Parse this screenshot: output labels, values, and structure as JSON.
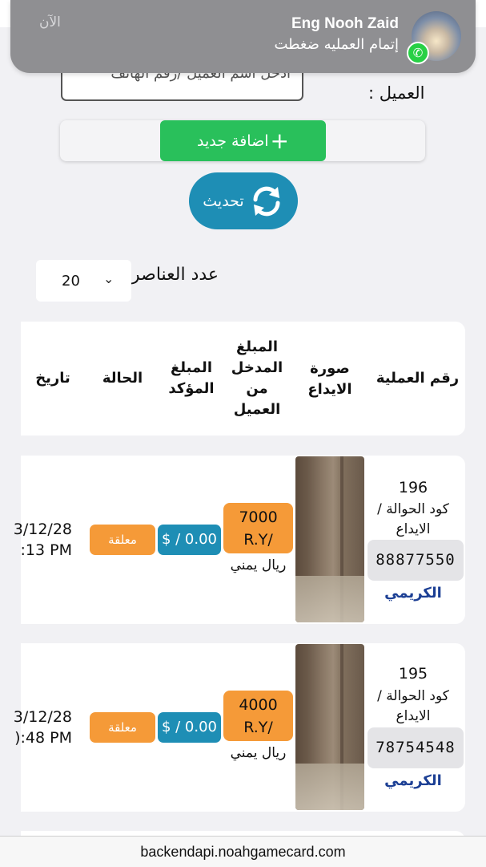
{
  "notification": {
    "title": "Eng Nooh Zaid",
    "body": "إتمام العمليه ضغطت",
    "time": "الآن",
    "badge_icon": "whatsapp-icon",
    "badge_color": "#27d045"
  },
  "client_search": {
    "label": "العميل :",
    "placeholder": "ادخل اسم العميل /رقم الهاتف"
  },
  "actions": {
    "add_label": "اضافة جديد",
    "add_icon": "plus-icon",
    "refresh_label": "تحديث",
    "refresh_icon": "refresh-icon"
  },
  "page_size": {
    "label": "عدد العناصر",
    "value": "20"
  },
  "table": {
    "headers": {
      "op_number": "رقم العملية",
      "photo": "صورة الايداع",
      "entered_amount": "المبلغ المدخل من العميل",
      "confirmed_amount": "المبلغ المؤكد",
      "status": "الحالة",
      "date": "تاريخ"
    },
    "rows": [
      {
        "op_number": "196",
        "code_label": "كود الحوالة / الايداع",
        "code": "88877550",
        "bank": "الكريمي",
        "amount": "7000",
        "amount_unit": "R.Y/",
        "currency": "ريال يمني",
        "confirmed": "$ / 0.00",
        "status": "معلقة",
        "date_line1": "3/12/28",
        "date_line2": ":13 PM"
      },
      {
        "op_number": "195",
        "code_label": "كود الحوالة / الايداع",
        "code": "78754548",
        "bank": "الكريمي",
        "amount": "4000",
        "amount_unit": "R.Y/",
        "currency": "ريال يمني",
        "confirmed": "$ / 0.00",
        "status": "معلقة",
        "date_line1": "3/12/28",
        "date_line2": "):48 PM"
      }
    ]
  },
  "browser": {
    "url": "backendapi.noahgamecard.com"
  },
  "colors": {
    "green": "#29c05b",
    "blue": "#1e8eb5",
    "orange": "#f59a38",
    "bank_text": "#1c3f94"
  }
}
